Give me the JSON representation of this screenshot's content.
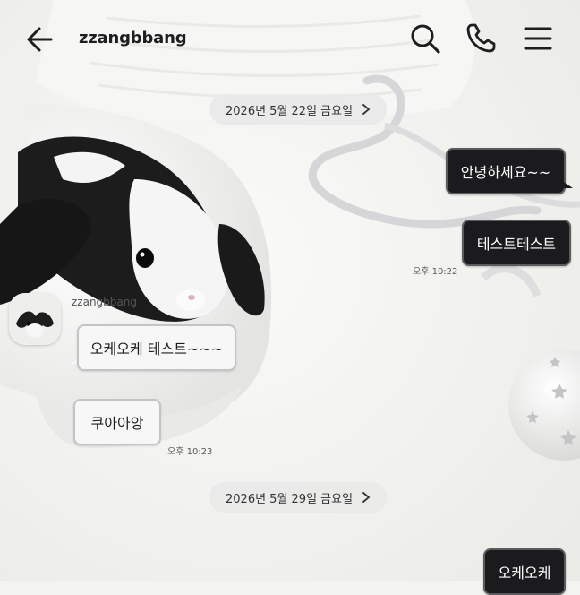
{
  "header": {
    "title": "zzangbbang",
    "icons": [
      "back-arrow-icon",
      "search-icon",
      "phone-icon",
      "menu-icon"
    ]
  },
  "dates": [
    {
      "label": "2026년 5월 22일 금요일"
    },
    {
      "label": "2026년 5월 29일 금요일"
    }
  ],
  "messages": {
    "out1": "안녕하세요~~",
    "out2": "테스트테스트",
    "out1_time": "오후 10:22",
    "sender": "zzangbbang",
    "in1": "오케오케 테스트~~~",
    "in2": "쿠아아앙",
    "in_time": "오후 10:23",
    "out3": "오케오케"
  },
  "colors": {
    "outgoing_bubble": "#1b1b1d",
    "incoming_bubble": "#f7f7f7",
    "date_pill": "#e8e8e8"
  }
}
